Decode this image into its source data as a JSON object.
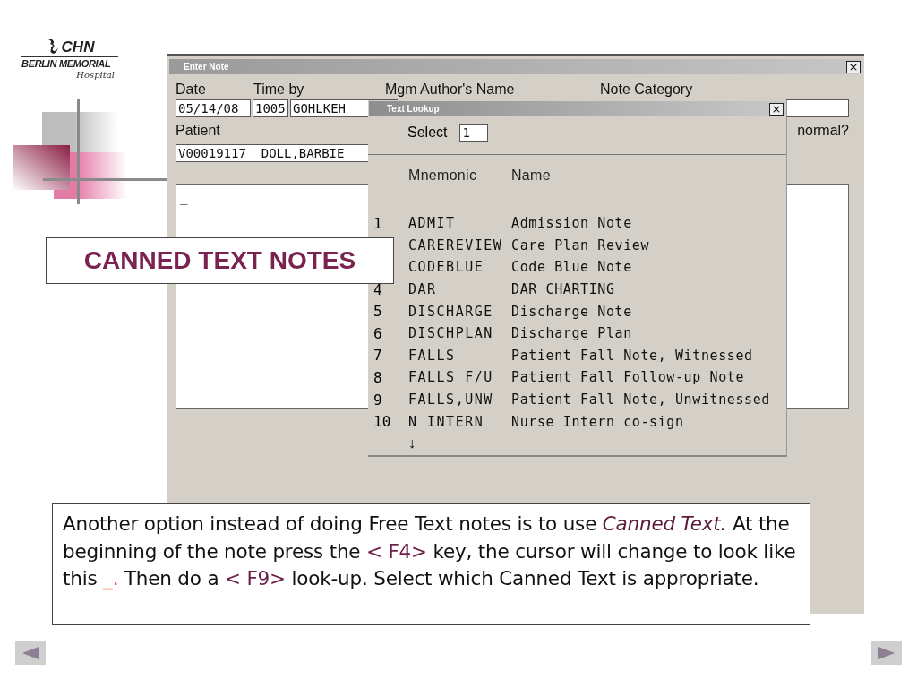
{
  "logo": {
    "brand": "CHN",
    "name": "BERLIN MEMORIAL",
    "subtitle": "Hospital"
  },
  "enter_note": {
    "title": "Enter Note",
    "close": "×",
    "labels": [
      "Date",
      "Time by",
      "Mgm Author's Name",
      "Note Category"
    ],
    "date": "05/14/08",
    "time": "1005",
    "by": "GOHLKEH",
    "patient_label": "Patient",
    "abnormal_label": "normal?",
    "patient": "V00019117  DOLL,BARBIE",
    "note_text": "_"
  },
  "text_lookup": {
    "title": "Text Lookup",
    "close": "×",
    "select_label": "Select",
    "select_value": "1",
    "columns": [
      "Mnemonic",
      "Name"
    ],
    "rows": [
      {
        "number": "1",
        "mnemonic": "ADMIT",
        "name": "Admission Note"
      },
      {
        "mnemonic": "CAREREVIEW",
        "name": "Care Plan Review"
      },
      {
        "mnemonic": "CODEBLUE",
        "name": "Code Blue Note"
      },
      {
        "number": "4",
        "mnemonic": "DAR",
        "name": "DAR CHARTING"
      },
      {
        "number": "5",
        "mnemonic": "DISCHARGE",
        "name": "Discharge Note"
      },
      {
        "number": "6",
        "mnemonic": "DISCHPLAN",
        "name": "Discharge Plan"
      },
      {
        "number": "7",
        "mnemonic": "FALLS",
        "name": "Patient Fall Note, Witnessed"
      },
      {
        "number": "8",
        "mnemonic": "FALLS F/U",
        "name": "Patient Fall Follow-up Note"
      },
      {
        "number": "9",
        "mnemonic": "FALLS,UNW",
        "name": "Patient Fall Note, Unwitnessed"
      },
      {
        "number": "10",
        "mnemonic": "N INTERN",
        "name": "Nurse Intern co-sign"
      }
    ],
    "more": "↓"
  },
  "heading": "CANNED TEXT NOTES",
  "paragraph": [
    {
      "kind": "plain",
      "text": "Another option instead of doing Free Text notes is to use "
    },
    {
      "kind": "term",
      "text": "Canned Text."
    },
    {
      "kind": "plain",
      "text": " At the beginning of the note press the "
    },
    {
      "kind": "key",
      "text": "< F4>"
    },
    {
      "kind": "plain",
      "text": " key, the cursor will change to look like this "
    },
    {
      "kind": "cursor",
      "text": "_."
    },
    {
      "kind": "plain",
      "text": " Then do a "
    },
    {
      "kind": "key",
      "text": "< F9>"
    },
    {
      "kind": "plain",
      "text": " look-up. Select which Canned Text is appropriate."
    }
  ]
}
